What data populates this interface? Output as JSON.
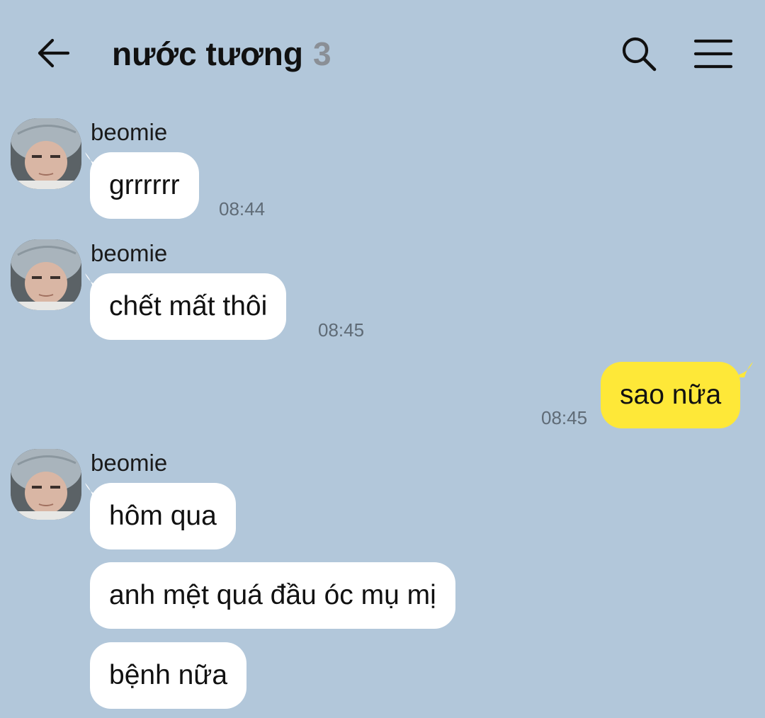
{
  "header": {
    "title": "nước tương",
    "member_count": "3",
    "back_icon": "arrow-left-icon",
    "search_icon": "search-icon",
    "menu_icon": "hamburger-menu-icon"
  },
  "colors": {
    "background": "#b2c7da",
    "incoming_bubble": "#ffffff",
    "outgoing_bubble": "#fee838",
    "timestamp": "#5f6b76",
    "member_count": "#8a8f96"
  },
  "messages": [
    {
      "sender": "beomie",
      "text": "grrrrrr",
      "time": "08:44"
    },
    {
      "sender": "beomie",
      "text": "chết mất thôi",
      "time": "08:45"
    },
    {
      "sender": "me",
      "text": "sao nữa",
      "time": "08:45"
    },
    {
      "sender": "beomie",
      "text": "hôm qua"
    },
    {
      "sender": "beomie",
      "text": "anh mệt quá đầu óc mụ mị"
    },
    {
      "sender": "beomie",
      "text": "bệnh nữa"
    }
  ]
}
